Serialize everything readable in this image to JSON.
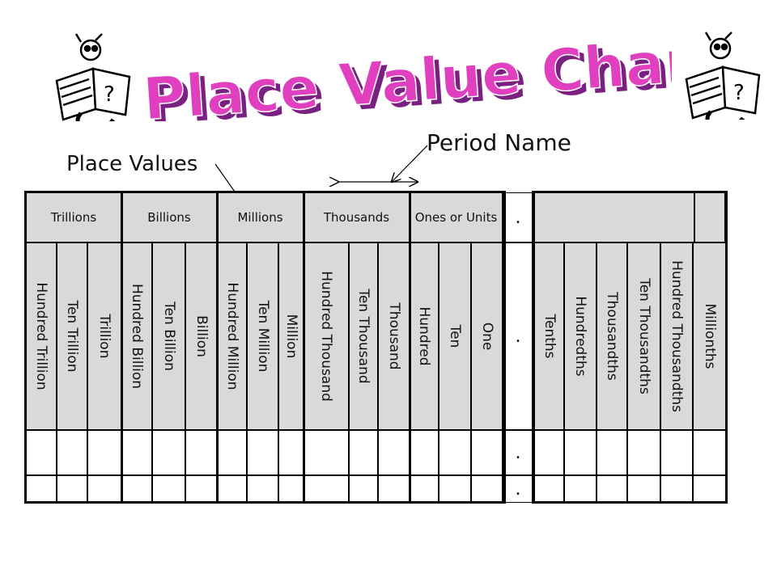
{
  "title": "Place Value Chart",
  "labels": {
    "period_name": "Period Name",
    "place_values": "Place Values"
  },
  "periods": [
    {
      "name": "Trillions",
      "places": [
        "Hundred Trillion",
        "Ten Trillion",
        "Trillion"
      ]
    },
    {
      "name": "Billions",
      "places": [
        "Hundred Billion",
        "Ten Billion",
        "Billion"
      ]
    },
    {
      "name": "Millions",
      "places": [
        "Hundred Million",
        "Ten Million",
        "Million"
      ]
    },
    {
      "name": "Thousands",
      "places": [
        "Hundred Thousand",
        "Ten Thousand",
        "Thousand"
      ]
    },
    {
      "name": "Ones or Units",
      "places": [
        "Hundred",
        "Ten",
        "One"
      ]
    }
  ],
  "decimal_point": ".",
  "decimal_places": [
    "Tenths",
    "Hundredths",
    "Thousandths",
    "Ten Thousandths",
    "Hundred Thousandths",
    "Millionths"
  ],
  "colors": {
    "title_fill": "#e040c0",
    "title_shade": "#7a2080",
    "header_bg": "#d9d9d9",
    "border": "#000000"
  },
  "icons": [
    "bookworm-reading-icon",
    "bookworm-reading-icon"
  ]
}
